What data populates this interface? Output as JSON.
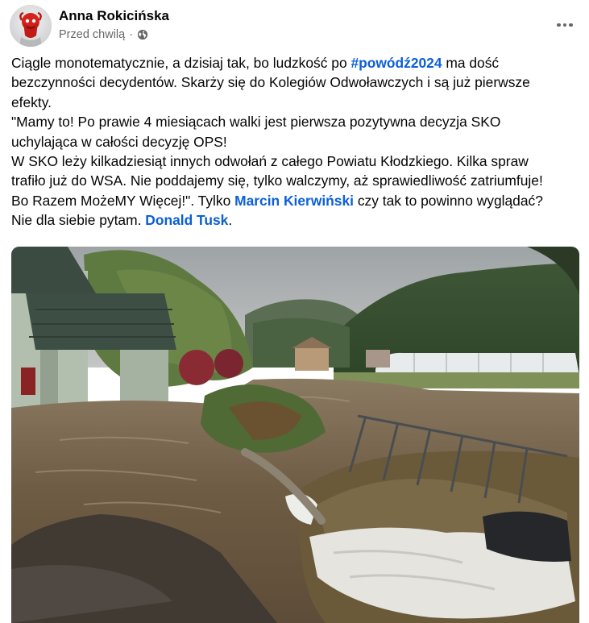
{
  "post": {
    "author": "Anna Rokicińska",
    "time": "Przed chwilą",
    "separator": "·",
    "privacy_icon": "globe-icon",
    "menu_icon": "more-options-icon",
    "text_lines": [
      [
        {
          "t": "Ciągle monotematycznie, a dzisiaj tak, bo ludzkość po "
        },
        {
          "t": "#powódź2024",
          "link": true
        },
        {
          "t": " ma dość"
        }
      ],
      [
        {
          "t": "bezczynności decydentów. Skarży się do Kolegiów Odwoławczych i są już pierwsze"
        }
      ],
      [
        {
          "t": "efekty."
        }
      ],
      [
        {
          "t": "\"Mamy to! Po prawie 4 miesiącach walki jest pierwsza pozytywna decyzja SKO"
        }
      ],
      [
        {
          "t": "uchylająca w całości decyzję OPS!"
        }
      ],
      [
        {
          "t": "W SKO leży kilkadziesiąt innych odwołań z całego Powiatu Kłodzkiego. Kilka spraw"
        }
      ],
      [
        {
          "t": "trafiło już do WSA. Nie poddajemy się, tylko walczymy, aż sprawiedliwość zatriumfuje!"
        }
      ],
      [
        {
          "t": "Bo Razem MożeMY Więcej!\". Tylko "
        },
        {
          "t": "Marcin Kierwiński",
          "link": true
        },
        {
          "t": " czy tak to powinno wyglądać?"
        }
      ],
      [
        {
          "t": "Nie dla siebie pytam. "
        },
        {
          "t": "Donald Tusk",
          "link": true
        },
        {
          "t": "."
        }
      ]
    ]
  },
  "colors": {
    "link": "#0b5fd8",
    "meta": "#65676b",
    "text": "#050505"
  }
}
